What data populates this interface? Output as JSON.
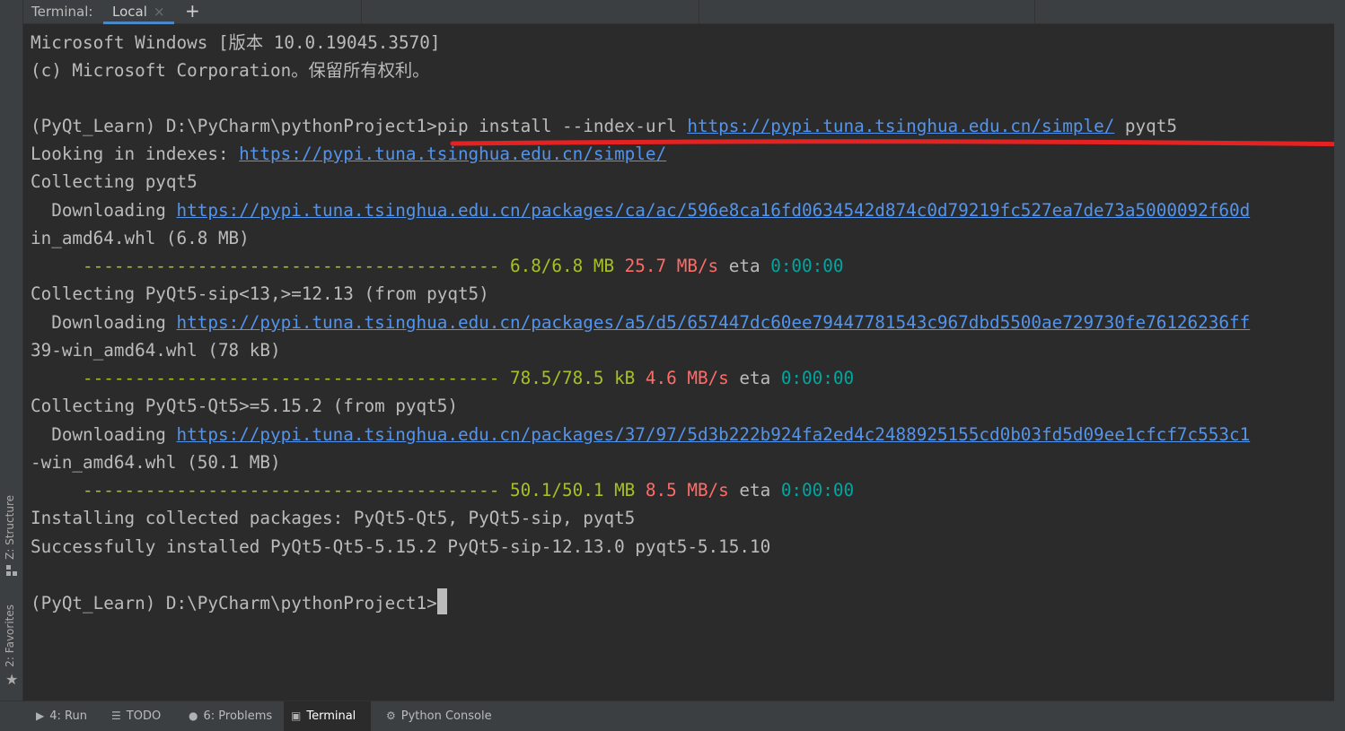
{
  "tabs": {
    "caption": "Terminal:",
    "local_label": "Local",
    "close_glyph": "×",
    "add_glyph": "+"
  },
  "left_tools": [
    {
      "label": "Z: Structure",
      "icon": "structure-icon"
    },
    {
      "label": "2: Favorites",
      "icon": "star-icon"
    }
  ],
  "terminal": {
    "l1": "Microsoft Windows [版本 10.0.19045.3570]",
    "l2": "(c) Microsoft Corporation。保留所有权利。",
    "l3_prompt": "(PyQt_Learn) D:\\PyCharm\\pythonProject1>",
    "l3_cmd": "pip install --index-url ",
    "l3_url": "https://pypi.tuna.tsinghua.edu.cn/simple/",
    "l3_tail": " pyqt5",
    "l4_text": "Looking in indexes: ",
    "l4_url": "https://pypi.tuna.tsinghua.edu.cn/simple/",
    "l5": "Collecting pyqt5",
    "l6_text": "  Downloading ",
    "l6_url": "https://pypi.tuna.tsinghua.edu.cn/packages/ca/ac/596e8ca16fd0634542d874c0d79219fc527ea7de73a5000092f60d",
    "l7": "in_amd64.whl (6.8 MB)",
    "l8_bar": "     ----------------------------------------",
    "l8_size": " 6.8/6.8 MB",
    "l8_speed": " 25.7 MB/s",
    "l8_eta_label": " eta ",
    "l8_eta": "0:00:00",
    "l9": "Collecting PyQt5-sip<13,>=12.13 (from pyqt5)",
    "l10_text": "  Downloading ",
    "l10_url": "https://pypi.tuna.tsinghua.edu.cn/packages/a5/d5/657447dc60ee79447781543c967dbd5500ae729730fe76126236ff",
    "l11": "39-win_amd64.whl (78 kB)",
    "l12_bar": "     ----------------------------------------",
    "l12_size": " 78.5/78.5 kB",
    "l12_speed": " 4.6 MB/s",
    "l12_eta_label": " eta ",
    "l12_eta": "0:00:00",
    "l13": "Collecting PyQt5-Qt5>=5.15.2 (from pyqt5)",
    "l14_text": "  Downloading ",
    "l14_url": "https://pypi.tuna.tsinghua.edu.cn/packages/37/97/5d3b222b924fa2ed4c2488925155cd0b03fd5d09ee1cfcf7c553c1",
    "l15": "-win_amd64.whl (50.1 MB)",
    "l16_bar": "     ----------------------------------------",
    "l16_size": " 50.1/50.1 MB",
    "l16_speed": " 8.5 MB/s",
    "l16_eta_label": " eta ",
    "l16_eta": "0:00:00",
    "l17": "Installing collected packages: PyQt5-Qt5, PyQt5-sip, pyqt5",
    "l18": "Successfully installed PyQt5-Qt5-5.15.2 PyQt5-sip-12.13.0 pyqt5-5.15.10",
    "l20_prompt": "(PyQt_Learn) D:\\PyCharm\\pythonProject1>"
  },
  "bottom_tools": [
    {
      "label": "4: Run",
      "icon": "run-icon"
    },
    {
      "label": "TODO",
      "icon": "todo-icon"
    },
    {
      "label": "6: Problems",
      "icon": "problems-icon"
    },
    {
      "label": "Terminal",
      "icon": "terminal-icon",
      "active": true
    },
    {
      "label": "Python Console",
      "icon": "python-icon"
    }
  ],
  "colors": {
    "background": "#2b2b2b",
    "text": "#bbbbbb",
    "link": "#5394ec",
    "progress_green": "#a8c023",
    "speed_red": "#ff6b68",
    "eta_cyan": "#00a6a0",
    "annotation_red": "#e52222"
  }
}
